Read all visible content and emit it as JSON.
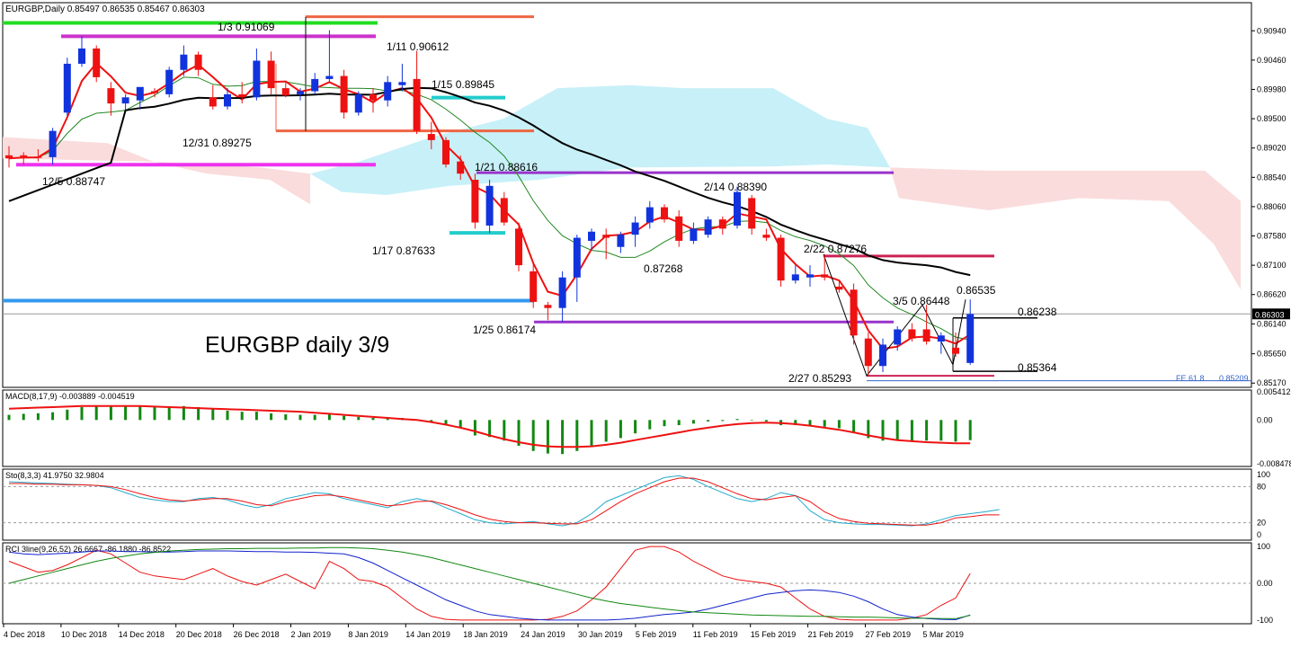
{
  "chart_data": {
    "type": "candlestick",
    "symbol_header": "EURGBP,Daily  0.85497 0.86535 0.85467 0.86303",
    "overlay_title": "EURGBP daily 3/9",
    "current_price": "0.86303",
    "price_axis_labels": [
      "0.90940",
      "0.90460",
      "0.89980",
      "0.89500",
      "0.89020",
      "0.88540",
      "0.88060",
      "0.87580",
      "0.87100",
      "0.86620",
      "0.86140",
      "0.85650",
      "0.85170"
    ],
    "price_range": [
      0.851,
      0.914
    ],
    "x_axis_labels": [
      "4 Dec 2018",
      "10 Dec 2018",
      "14 Dec 2018",
      "20 Dec 2018",
      "26 Dec 2018",
      "2 Jan 2019",
      "8 Jan 2019",
      "14 Jan 2019",
      "18 Jan 2019",
      "24 Jan 2019",
      "30 Jan 2019",
      "5 Feb 2019",
      "11 Feb 2019",
      "15 Feb 2019",
      "21 Feb 2019",
      "27 Feb 2019",
      "5 Mar 2019"
    ],
    "candles": [
      {
        "o": 0.889,
        "h": 0.8905,
        "l": 0.887,
        "c": 0.8885
      },
      {
        "o": 0.889,
        "h": 0.8895,
        "l": 0.8875,
        "c": 0.8888
      },
      {
        "o": 0.8888,
        "h": 0.89,
        "l": 0.888,
        "c": 0.8887
      },
      {
        "o": 0.8887,
        "h": 0.8935,
        "l": 0.8875,
        "c": 0.893
      },
      {
        "o": 0.896,
        "h": 0.905,
        "l": 0.8955,
        "c": 0.904
      },
      {
        "o": 0.904,
        "h": 0.9085,
        "l": 0.9035,
        "c": 0.9065
      },
      {
        "o": 0.9065,
        "h": 0.907,
        "l": 0.901,
        "c": 0.9018
      },
      {
        "o": 0.9,
        "h": 0.901,
        "l": 0.8955,
        "c": 0.8975
      },
      {
        "o": 0.8975,
        "h": 0.899,
        "l": 0.8965,
        "c": 0.8985
      },
      {
        "o": 0.898,
        "h": 0.9,
        "l": 0.8965,
        "c": 0.9002
      },
      {
        "o": 0.8995,
        "h": 0.9,
        "l": 0.8985,
        "c": 0.8992
      },
      {
        "o": 0.899,
        "h": 0.9035,
        "l": 0.8985,
        "c": 0.903
      },
      {
        "o": 0.903,
        "h": 0.907,
        "l": 0.902,
        "c": 0.9055
      },
      {
        "o": 0.9055,
        "h": 0.906,
        "l": 0.902,
        "c": 0.903
      },
      {
        "o": 0.8985,
        "h": 0.9005,
        "l": 0.8965,
        "c": 0.897
      },
      {
        "o": 0.897,
        "h": 0.9,
        "l": 0.8965,
        "c": 0.899
      },
      {
        "o": 0.899,
        "h": 0.901,
        "l": 0.8975,
        "c": 0.8985
      },
      {
        "o": 0.8985,
        "h": 0.9065,
        "l": 0.898,
        "c": 0.9045
      },
      {
        "o": 0.9045,
        "h": 0.906,
        "l": 0.899,
        "c": 0.9
      },
      {
        "o": 0.9,
        "h": 0.901,
        "l": 0.8985,
        "c": 0.8988
      },
      {
        "o": 0.899,
        "h": 0.9,
        "l": 0.898,
        "c": 0.8995
      },
      {
        "o": 0.8995,
        "h": 0.9025,
        "l": 0.899,
        "c": 0.9015
      },
      {
        "o": 0.9015,
        "h": 0.9095,
        "l": 0.901,
        "c": 0.902
      },
      {
        "o": 0.902,
        "h": 0.903,
        "l": 0.895,
        "c": 0.896
      },
      {
        "o": 0.896,
        "h": 0.8995,
        "l": 0.8955,
        "c": 0.899
      },
      {
        "o": 0.899,
        "h": 0.9,
        "l": 0.896,
        "c": 0.898
      },
      {
        "o": 0.898,
        "h": 0.902,
        "l": 0.897,
        "c": 0.901
      },
      {
        "o": 0.9005,
        "h": 0.904,
        "l": 0.8995,
        "c": 0.901
      },
      {
        "o": 0.9015,
        "h": 0.9061,
        "l": 0.8925,
        "c": 0.893
      },
      {
        "o": 0.8925,
        "h": 0.8945,
        "l": 0.89,
        "c": 0.8915
      },
      {
        "o": 0.8915,
        "h": 0.892,
        "l": 0.887,
        "c": 0.8875
      },
      {
        "o": 0.888,
        "h": 0.889,
        "l": 0.885,
        "c": 0.886
      },
      {
        "o": 0.885,
        "h": 0.886,
        "l": 0.877,
        "c": 0.878
      },
      {
        "o": 0.8775,
        "h": 0.885,
        "l": 0.8763,
        "c": 0.884
      },
      {
        "o": 0.882,
        "h": 0.883,
        "l": 0.8775,
        "c": 0.878
      },
      {
        "o": 0.877,
        "h": 0.878,
        "l": 0.87,
        "c": 0.871
      },
      {
        "o": 0.87,
        "h": 0.8715,
        "l": 0.864,
        "c": 0.865
      },
      {
        "o": 0.8645,
        "h": 0.865,
        "l": 0.862,
        "c": 0.864
      },
      {
        "o": 0.864,
        "h": 0.87,
        "l": 0.8617,
        "c": 0.869
      },
      {
        "o": 0.869,
        "h": 0.876,
        "l": 0.865,
        "c": 0.8755
      },
      {
        "o": 0.875,
        "h": 0.877,
        "l": 0.8735,
        "c": 0.8765
      },
      {
        "o": 0.876,
        "h": 0.877,
        "l": 0.872,
        "c": 0.8755
      },
      {
        "o": 0.874,
        "h": 0.8765,
        "l": 0.873,
        "c": 0.876
      },
      {
        "o": 0.876,
        "h": 0.879,
        "l": 0.874,
        "c": 0.878
      },
      {
        "o": 0.878,
        "h": 0.8815,
        "l": 0.877,
        "c": 0.8805
      },
      {
        "o": 0.8805,
        "h": 0.881,
        "l": 0.878,
        "c": 0.8785
      },
      {
        "o": 0.879,
        "h": 0.88,
        "l": 0.874,
        "c": 0.875
      },
      {
        "o": 0.875,
        "h": 0.878,
        "l": 0.8745,
        "c": 0.877
      },
      {
        "o": 0.876,
        "h": 0.879,
        "l": 0.8755,
        "c": 0.8785
      },
      {
        "o": 0.8785,
        "h": 0.879,
        "l": 0.876,
        "c": 0.877
      },
      {
        "o": 0.8775,
        "h": 0.8839,
        "l": 0.877,
        "c": 0.883
      },
      {
        "o": 0.882,
        "h": 0.8825,
        "l": 0.876,
        "c": 0.877
      },
      {
        "o": 0.876,
        "h": 0.877,
        "l": 0.875,
        "c": 0.8755
      },
      {
        "o": 0.8755,
        "h": 0.876,
        "l": 0.8675,
        "c": 0.8685
      },
      {
        "o": 0.8685,
        "h": 0.871,
        "l": 0.868,
        "c": 0.8695
      },
      {
        "o": 0.869,
        "h": 0.871,
        "l": 0.8675,
        "c": 0.8695
      },
      {
        "o": 0.8695,
        "h": 0.8728,
        "l": 0.8685,
        "c": 0.869
      },
      {
        "o": 0.8675,
        "h": 0.8685,
        "l": 0.8665,
        "c": 0.867
      },
      {
        "o": 0.867,
        "h": 0.868,
        "l": 0.858,
        "c": 0.8595
      },
      {
        "o": 0.859,
        "h": 0.86,
        "l": 0.8529,
        "c": 0.8545
      },
      {
        "o": 0.8545,
        "h": 0.859,
        "l": 0.8535,
        "c": 0.858
      },
      {
        "o": 0.858,
        "h": 0.861,
        "l": 0.857,
        "c": 0.8605
      },
      {
        "o": 0.8605,
        "h": 0.8615,
        "l": 0.8585,
        "c": 0.859
      },
      {
        "o": 0.8605,
        "h": 0.8645,
        "l": 0.858,
        "c": 0.8585
      },
      {
        "o": 0.8585,
        "h": 0.86,
        "l": 0.8565,
        "c": 0.8595
      },
      {
        "o": 0.8575,
        "h": 0.86,
        "l": 0.856,
        "c": 0.8565
      },
      {
        "o": 0.855,
        "h": 0.8654,
        "l": 0.8547,
        "c": 0.863
      }
    ],
    "horizontal_levels": [
      {
        "label": "1/3 0.91069",
        "price": 0.91069,
        "color": "#22dd22"
      },
      {
        "label": "",
        "price": 0.9085,
        "color": "#cc33cc"
      },
      {
        "label": "",
        "price": 0.9117,
        "color": "#ee6644"
      },
      {
        "label": "1/15 0.89845",
        "price": 0.89845,
        "color": "#22cccc"
      },
      {
        "label": "",
        "price": 0.893,
        "color": "#ee6644"
      },
      {
        "label": "12/5 0.88747",
        "price": 0.88747,
        "color": "#ee33ee"
      },
      {
        "label": "1/21 0.88616",
        "price": 0.88616,
        "color": "#9933cc"
      },
      {
        "label": "",
        "price": 0.8763,
        "color": "#22cccc"
      },
      {
        "label": "",
        "price": 0.8725,
        "color": "#cc2255"
      },
      {
        "label": "",
        "price": 0.8652,
        "color": "#3399ee"
      },
      {
        "label": "",
        "price": 0.8617,
        "color": "#9933cc"
      },
      {
        "label": "0.86238",
        "price": 0.86238,
        "color": "#000000"
      },
      {
        "label": "0.85364",
        "price": 0.85364,
        "color": "#000000"
      },
      {
        "label": "",
        "price": 0.8529,
        "color": "#cc2255"
      }
    ],
    "annotations": [
      "1/11 0.90612",
      "12/31 0.89275",
      "1/17 0.87633",
      "1/25 0.86174",
      "2/14 0.88390",
      "0.87268",
      "2/22 0.87276",
      "3/5 0.86448",
      "0.86535",
      "2/27 0.85293",
      "FE 61.8",
      "0.85209"
    ],
    "macd": {
      "header": "MACD(8,17,9) -0.003889 -0.004519",
      "axis_labels": [
        "0.005412",
        "0.00",
        "-0.008478"
      ],
      "range": [
        -0.009,
        0.0058
      ],
      "histogram": [
        0.001,
        0.0012,
        0.0013,
        0.0015,
        0.002,
        0.0025,
        0.0028,
        0.0028,
        0.0027,
        0.0028,
        0.0026,
        0.0026,
        0.0027,
        0.0025,
        0.0021,
        0.0018,
        0.0016,
        0.0016,
        0.0013,
        0.0011,
        0.001,
        0.001,
        0.0011,
        0.0008,
        0.0006,
        0.0004,
        0.0003,
        0.0004,
        0.0001,
        -0.0004,
        -0.001,
        -0.0016,
        -0.003,
        -0.0033,
        -0.004,
        -0.005,
        -0.006,
        -0.0065,
        -0.0066,
        -0.006,
        -0.005,
        -0.0042,
        -0.0035,
        -0.0026,
        -0.0018,
        -0.0012,
        -0.001,
        -0.0007,
        -0.0003,
        -0.0002,
        0.0002,
        -0.0001,
        -0.0003,
        -0.001,
        -0.001,
        -0.0012,
        -0.0013,
        -0.0016,
        -0.0025,
        -0.0035,
        -0.004,
        -0.004,
        -0.0042,
        -0.004,
        -0.004,
        -0.0042,
        -0.0039
      ],
      "signal": [
        0.0022,
        0.0023,
        0.0024,
        0.0025,
        0.0026,
        0.0027,
        0.0027,
        0.0027,
        0.0027,
        0.0027,
        0.0026,
        0.0025,
        0.0024,
        0.0023,
        0.0022,
        0.0021,
        0.002,
        0.0019,
        0.0018,
        0.0017,
        0.0016,
        0.0014,
        0.0012,
        0.001,
        0.0008,
        0.0006,
        0.0004,
        0.0002,
        0.0,
        -0.0004,
        -0.0009,
        -0.0015,
        -0.0022,
        -0.003,
        -0.0037,
        -0.0043,
        -0.0048,
        -0.0051,
        -0.0052,
        -0.0052,
        -0.0051,
        -0.0048,
        -0.0044,
        -0.0039,
        -0.0034,
        -0.0029,
        -0.0024,
        -0.0019,
        -0.0015,
        -0.0011,
        -0.0008,
        -0.0006,
        -0.0005,
        -0.0006,
        -0.0008,
        -0.0011,
        -0.0015,
        -0.0019,
        -0.0024,
        -0.003,
        -0.0035,
        -0.0039,
        -0.0041,
        -0.0043,
        -0.0044,
        -0.0045,
        -0.0045
      ]
    },
    "stochastic": {
      "header": "Sto(8,3,3) 41.9750 32.9804",
      "axis_labels": [
        "100",
        "80",
        "20",
        "0"
      ],
      "range": [
        0,
        100
      ],
      "levels": [
        80,
        20
      ],
      "main": [
        88,
        87,
        86,
        85,
        84,
        83,
        82,
        78,
        70,
        62,
        58,
        55,
        55,
        60,
        62,
        58,
        50,
        45,
        50,
        60,
        65,
        70,
        68,
        60,
        55,
        50,
        45,
        55,
        60,
        55,
        45,
        35,
        25,
        20,
        18,
        20,
        22,
        18,
        15,
        20,
        35,
        55,
        65,
        75,
        85,
        95,
        98,
        92,
        80,
        70,
        60,
        55,
        60,
        70,
        65,
        40,
        25,
        20,
        18,
        17,
        17,
        16,
        15,
        18,
        25,
        32,
        35,
        38,
        42
      ],
      "signal": [
        85,
        85,
        84,
        84,
        83,
        83,
        82,
        80,
        75,
        68,
        62,
        58,
        56,
        58,
        60,
        60,
        56,
        50,
        48,
        55,
        60,
        65,
        66,
        63,
        58,
        53,
        48,
        50,
        55,
        56,
        50,
        42,
        33,
        26,
        22,
        20,
        20,
        19,
        18,
        18,
        25,
        40,
        55,
        68,
        78,
        88,
        94,
        94,
        88,
        78,
        68,
        60,
        58,
        62,
        65,
        55,
        38,
        27,
        22,
        19,
        18,
        17,
        16,
        16,
        20,
        28,
        30,
        33,
        33
      ]
    },
    "rci": {
      "header": "RCI 3line(9,26,52) 26.6667 -86.1880 -86.8522",
      "axis_labels": [
        "100",
        "0.00",
        "-100"
      ],
      "range": [
        -110,
        110
      ],
      "short": [
        60,
        45,
        30,
        35,
        50,
        70,
        90,
        80,
        55,
        30,
        20,
        15,
        10,
        25,
        40,
        20,
        5,
        -5,
        10,
        25,
        5,
        -15,
        60,
        40,
        10,
        5,
        -10,
        -40,
        -70,
        -90,
        -98,
        -100,
        -100,
        -100,
        -100,
        -100,
        -100,
        -98,
        -90,
        -75,
        -45,
        -10,
        40,
        90,
        100,
        100,
        85,
        60,
        40,
        20,
        10,
        5,
        0,
        -10,
        -40,
        -70,
        -90,
        -98,
        -100,
        -100,
        -100,
        -100,
        -95,
        -85,
        -60,
        -40,
        27
      ],
      "mid": [
        85,
        80,
        78,
        80,
        82,
        85,
        88,
        88,
        86,
        86,
        85,
        85,
        86,
        88,
        88,
        88,
        87,
        86,
        86,
        85,
        85,
        84,
        82,
        80,
        70,
        55,
        35,
        15,
        -5,
        -25,
        -45,
        -60,
        -75,
        -85,
        -90,
        -95,
        -98,
        -100,
        -100,
        -100,
        -100,
        -100,
        -98,
        -95,
        -90,
        -85,
        -82,
        -78,
        -70,
        -60,
        -50,
        -40,
        -30,
        -25,
        -20,
        -18,
        -20,
        -25,
        -35,
        -50,
        -70,
        -85,
        -92,
        -96,
        -98,
        -99,
        -86
      ],
      "long": [
        0,
        10,
        20,
        30,
        40,
        50,
        60,
        68,
        74,
        80,
        84,
        88,
        90,
        92,
        93,
        94,
        94,
        95,
        95,
        95,
        96,
        96,
        97,
        97,
        96,
        94,
        90,
        85,
        78,
        70,
        60,
        50,
        40,
        30,
        20,
        10,
        0,
        -10,
        -20,
        -30,
        -40,
        -48,
        -55,
        -60,
        -65,
        -70,
        -74,
        -78,
        -80,
        -82,
        -84,
        -86,
        -87,
        -88,
        -89,
        -90,
        -90,
        -91,
        -92,
        -92,
        -93,
        -94,
        -95,
        -95,
        -96,
        -96,
        -87
      ]
    }
  }
}
